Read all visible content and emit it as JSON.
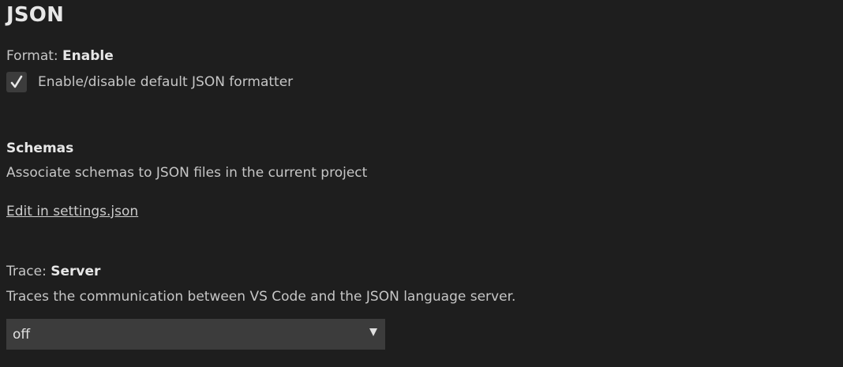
{
  "section": {
    "title": "JSON"
  },
  "format": {
    "category": "Format: ",
    "name": "Enable",
    "checkbox_label": "Enable/disable default JSON formatter",
    "checked": true
  },
  "schemas": {
    "name": "Schemas",
    "description": "Associate schemas to JSON files in the current project",
    "link_label": "Edit in settings.json"
  },
  "trace": {
    "category": "Trace: ",
    "name": "Server",
    "description": "Traces the communication between VS Code and the JSON language server.",
    "selected_value": "off",
    "arrow_icon": "dropdown-arrow-icon"
  },
  "colors": {
    "background": "#1e1e1e",
    "input_background": "#3c3c3c",
    "text": "#cccccc",
    "heading": "#e7e7e7"
  }
}
